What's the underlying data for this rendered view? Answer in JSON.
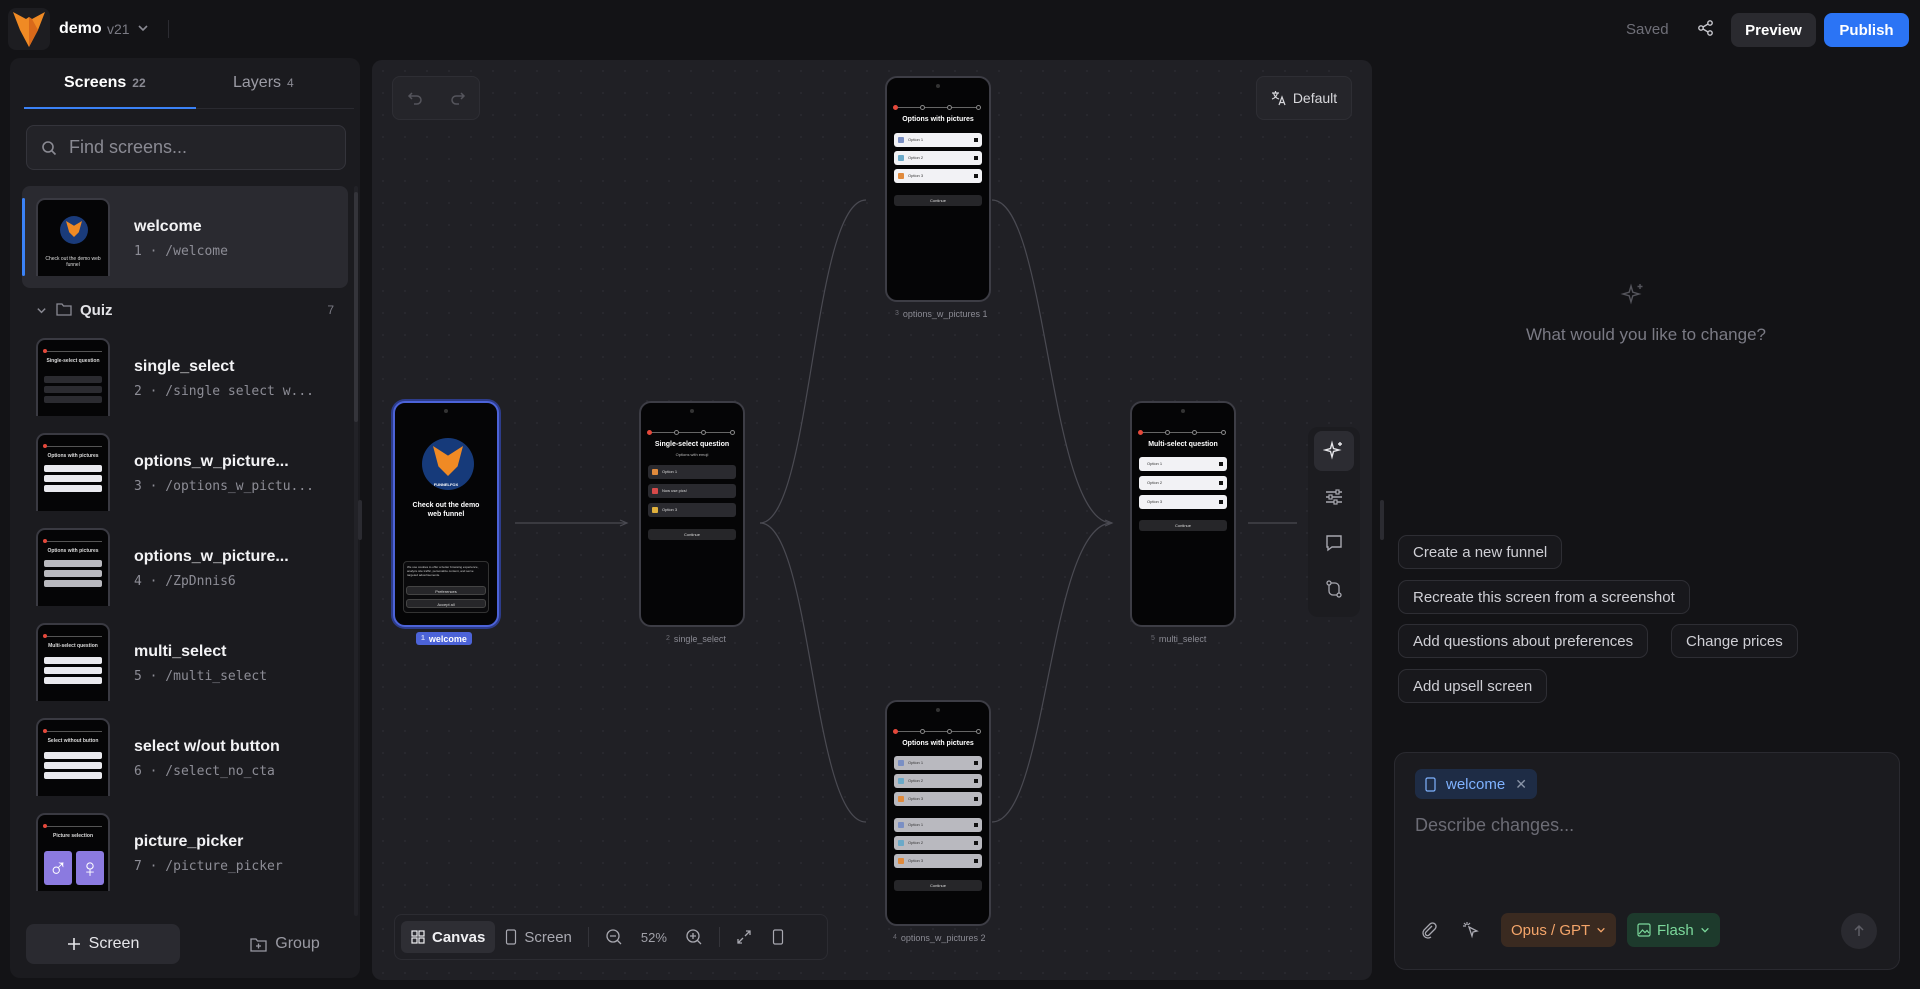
{
  "header": {
    "project_name": "demo",
    "version": "v21",
    "saved_status": "Saved",
    "preview_label": "Preview",
    "publish_label": "Publish"
  },
  "sidebar": {
    "tabs": [
      {
        "label": "Screens",
        "count": "22"
      },
      {
        "label": "Layers",
        "count": "4"
      }
    ],
    "search_placeholder": "Find screens...",
    "items": [
      {
        "name": "welcome",
        "index": "1",
        "path": "/welcome",
        "meta": "1 · /welcome",
        "thumb_title": "Check out the demo web funnel"
      },
      {
        "name": "single_select",
        "index": "2",
        "meta": "2 · /single select w...",
        "thumb_title": "Single-select question"
      },
      {
        "name": "options_w_picture...",
        "index": "3",
        "meta": "3 · /options_w_pictu...",
        "thumb_title": "Options with pictures"
      },
      {
        "name": "options_w_picture...",
        "index": "4",
        "meta": "4 · /ZpDnnis6",
        "thumb_title": "Options with pictures"
      },
      {
        "name": "multi_select",
        "index": "5",
        "meta": "5 · /multi_select",
        "thumb_title": "Multi-select question"
      },
      {
        "name": "select w/out button",
        "index": "6",
        "meta": "6 · /select_no_cta",
        "thumb_title": "Select without button"
      },
      {
        "name": "picture_picker",
        "index": "7",
        "meta": "7 · /picture_picker",
        "thumb_title": "Picture selection"
      }
    ],
    "group": {
      "name": "Quiz",
      "count": "7"
    },
    "add_screen_label": "Screen",
    "add_group_label": "Group"
  },
  "canvas": {
    "language_label": "Default",
    "view_canvas_label": "Canvas",
    "view_screen_label": "Screen",
    "zoom": "52%",
    "nodes": [
      {
        "id": "welcome",
        "num": "1",
        "label": "welcome",
        "title": "Check out the demo web funnel",
        "brand": "FUNNELFOX",
        "consent": "We use cookies to offer a better browsing experience, analyze site traffic, personalize content, and serve targeted advertisements.",
        "btn1": "Preferences",
        "btn2": "Accept all"
      },
      {
        "id": "single_select",
        "num": "2",
        "label": "single_select",
        "title": "Single-select question",
        "subtitle": "Options with emoji",
        "options": [
          "Option 1",
          "Now use pics!",
          "Option 3"
        ],
        "cta": "Continue"
      },
      {
        "id": "options_w_pictures_1",
        "num": "3",
        "label": "options_w_pictures 1",
        "title": "Options with pictures",
        "options": [
          "Option 1",
          "Option 2",
          "Option 3"
        ],
        "cta": "Continue"
      },
      {
        "id": "multi_select",
        "num": "5",
        "label": "multi_select",
        "title": "Multi-select question",
        "options": [
          "Option 1",
          "Option 2",
          "Option 3"
        ],
        "cta": "Continue"
      },
      {
        "id": "options_w_pictures_2",
        "num": "4",
        "label": "options_w_pictures 2",
        "title": "Options with pictures",
        "options": [
          "Option 1",
          "Option 2",
          "Option 3",
          "Option 1",
          "Option 2",
          "Option 3"
        ],
        "cta": "Continue"
      }
    ]
  },
  "ai_panel": {
    "prompt": "What would you like to change?",
    "suggestions": [
      "Create a new funnel",
      "Recreate this screen from a screenshot",
      "Add questions about preferences",
      "Change prices",
      "Add upsell screen"
    ],
    "context_chip": "welcome",
    "input_placeholder": "Describe changes...",
    "model_label": "Opus / GPT",
    "image_model_label": "Flash"
  },
  "colors": {
    "accent": "#2b74f5",
    "selection": "#4c63d8",
    "progress_dot": "#e5483b",
    "model_chip": "#f4a56a",
    "flash_chip": "#7bd89b"
  }
}
